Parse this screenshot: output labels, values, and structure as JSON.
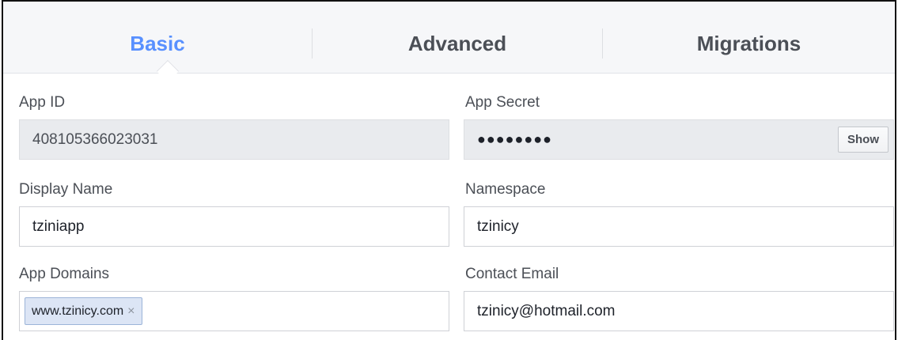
{
  "tabs": [
    {
      "label": "Basic",
      "active": true
    },
    {
      "label": "Advanced",
      "active": false
    },
    {
      "label": "Migrations",
      "active": false
    }
  ],
  "fields": {
    "app_id": {
      "label": "App ID",
      "value": "408105366023031"
    },
    "app_secret": {
      "label": "App Secret",
      "value": "●●●●●●●●",
      "show_label": "Show"
    },
    "display_name": {
      "label": "Display Name",
      "value": "tziniapp"
    },
    "namespace": {
      "label": "Namespace",
      "value": "tzinicy"
    },
    "app_domains": {
      "label": "App Domains",
      "tokens": [
        "www.tzinicy.com"
      ],
      "remove_glyph": "×"
    },
    "contact_email": {
      "label": "Contact Email",
      "value": "tzinicy@hotmail.com"
    }
  },
  "colors": {
    "accent": "#5890ff",
    "tab_bg": "#f6f7f9",
    "readonly_bg": "#e9ebee",
    "token_bg": "#dce5f5"
  }
}
